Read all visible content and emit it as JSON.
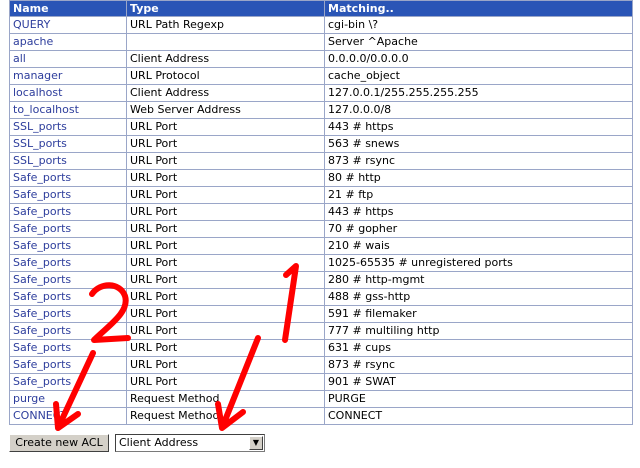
{
  "table": {
    "headers": [
      "Name",
      "Type",
      "Matching.."
    ],
    "rows": [
      {
        "name": "QUERY",
        "type": "URL Path Regexp",
        "matching": "cgi-bin \\?"
      },
      {
        "name": "apache",
        "type": "",
        "matching": "Server ^Apache"
      },
      {
        "name": "all",
        "type": "Client Address",
        "matching": "0.0.0.0/0.0.0.0"
      },
      {
        "name": "manager",
        "type": "URL Protocol",
        "matching": "cache_object"
      },
      {
        "name": "localhost",
        "type": "Client Address",
        "matching": "127.0.0.1/255.255.255.255"
      },
      {
        "name": "to_localhost",
        "type": "Web Server Address",
        "matching": "127.0.0.0/8"
      },
      {
        "name": "SSL_ports",
        "type": "URL Port",
        "matching": "443 # https"
      },
      {
        "name": "SSL_ports",
        "type": "URL Port",
        "matching": "563 # snews"
      },
      {
        "name": "SSL_ports",
        "type": "URL Port",
        "matching": "873 # rsync"
      },
      {
        "name": "Safe_ports",
        "type": "URL Port",
        "matching": "80 # http"
      },
      {
        "name": "Safe_ports",
        "type": "URL Port",
        "matching": "21 # ftp"
      },
      {
        "name": "Safe_ports",
        "type": "URL Port",
        "matching": "443 # https"
      },
      {
        "name": "Safe_ports",
        "type": "URL Port",
        "matching": "70 # gopher"
      },
      {
        "name": "Safe_ports",
        "type": "URL Port",
        "matching": "210 # wais"
      },
      {
        "name": "Safe_ports",
        "type": "URL Port",
        "matching": "1025-65535 # unregistered ports"
      },
      {
        "name": "Safe_ports",
        "type": "URL Port",
        "matching": "280 # http-mgmt"
      },
      {
        "name": "Safe_ports",
        "type": "URL Port",
        "matching": "488 # gss-http"
      },
      {
        "name": "Safe_ports",
        "type": "URL Port",
        "matching": "591 # filemaker"
      },
      {
        "name": "Safe_ports",
        "type": "URL Port",
        "matching": "777 # multiling http"
      },
      {
        "name": "Safe_ports",
        "type": "URL Port",
        "matching": "631 # cups"
      },
      {
        "name": "Safe_ports",
        "type": "URL Port",
        "matching": "873 # rsync"
      },
      {
        "name": "Safe_ports",
        "type": "URL Port",
        "matching": "901 # SWAT"
      },
      {
        "name": "purge",
        "type": "Request Method",
        "matching": "PURGE"
      },
      {
        "name": "CONNECT",
        "type": "Request Method",
        "matching": "CONNECT"
      }
    ]
  },
  "controls": {
    "create_label": "Create new ACL",
    "select_value": "Client Address"
  },
  "annotations": {
    "color": "#ff0000",
    "label_1": "1",
    "label_2": "2"
  },
  "colors": {
    "header_bg": "#2a55b6",
    "link": "#2d3d9c"
  }
}
